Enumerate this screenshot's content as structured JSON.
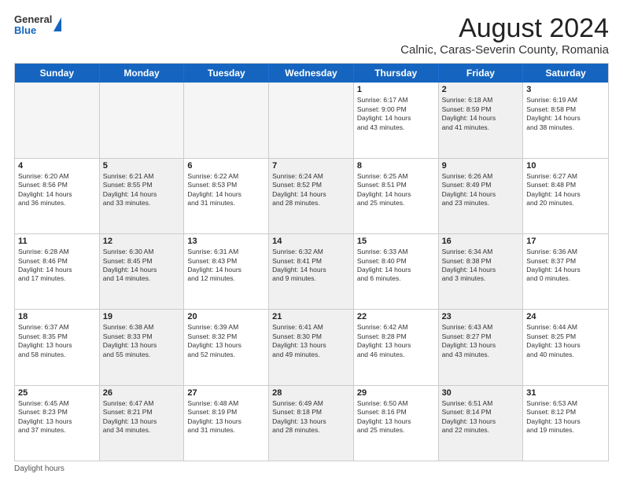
{
  "logo": {
    "general": "General",
    "blue": "Blue"
  },
  "title": "August 2024",
  "subtitle": "Calnic, Caras-Severin County, Romania",
  "days_of_week": [
    "Sunday",
    "Monday",
    "Tuesday",
    "Wednesday",
    "Thursday",
    "Friday",
    "Saturday"
  ],
  "weeks": [
    [
      {
        "day": "",
        "empty": true
      },
      {
        "day": "",
        "empty": true
      },
      {
        "day": "",
        "empty": true
      },
      {
        "day": "",
        "empty": true
      },
      {
        "day": "1",
        "shaded": false,
        "lines": [
          "Sunrise: 6:17 AM",
          "Sunset: 9:00 PM",
          "Daylight: 14 hours",
          "and 43 minutes."
        ]
      },
      {
        "day": "2",
        "shaded": true,
        "lines": [
          "Sunrise: 6:18 AM",
          "Sunset: 8:59 PM",
          "Daylight: 14 hours",
          "and 41 minutes."
        ]
      },
      {
        "day": "3",
        "shaded": false,
        "lines": [
          "Sunrise: 6:19 AM",
          "Sunset: 8:58 PM",
          "Daylight: 14 hours",
          "and 38 minutes."
        ]
      }
    ],
    [
      {
        "day": "4",
        "shaded": false,
        "lines": [
          "Sunrise: 6:20 AM",
          "Sunset: 8:56 PM",
          "Daylight: 14 hours",
          "and 36 minutes."
        ]
      },
      {
        "day": "5",
        "shaded": true,
        "lines": [
          "Sunrise: 6:21 AM",
          "Sunset: 8:55 PM",
          "Daylight: 14 hours",
          "and 33 minutes."
        ]
      },
      {
        "day": "6",
        "shaded": false,
        "lines": [
          "Sunrise: 6:22 AM",
          "Sunset: 8:53 PM",
          "Daylight: 14 hours",
          "and 31 minutes."
        ]
      },
      {
        "day": "7",
        "shaded": true,
        "lines": [
          "Sunrise: 6:24 AM",
          "Sunset: 8:52 PM",
          "Daylight: 14 hours",
          "and 28 minutes."
        ]
      },
      {
        "day": "8",
        "shaded": false,
        "lines": [
          "Sunrise: 6:25 AM",
          "Sunset: 8:51 PM",
          "Daylight: 14 hours",
          "and 25 minutes."
        ]
      },
      {
        "day": "9",
        "shaded": true,
        "lines": [
          "Sunrise: 6:26 AM",
          "Sunset: 8:49 PM",
          "Daylight: 14 hours",
          "and 23 minutes."
        ]
      },
      {
        "day": "10",
        "shaded": false,
        "lines": [
          "Sunrise: 6:27 AM",
          "Sunset: 8:48 PM",
          "Daylight: 14 hours",
          "and 20 minutes."
        ]
      }
    ],
    [
      {
        "day": "11",
        "shaded": false,
        "lines": [
          "Sunrise: 6:28 AM",
          "Sunset: 8:46 PM",
          "Daylight: 14 hours",
          "and 17 minutes."
        ]
      },
      {
        "day": "12",
        "shaded": true,
        "lines": [
          "Sunrise: 6:30 AM",
          "Sunset: 8:45 PM",
          "Daylight: 14 hours",
          "and 14 minutes."
        ]
      },
      {
        "day": "13",
        "shaded": false,
        "lines": [
          "Sunrise: 6:31 AM",
          "Sunset: 8:43 PM",
          "Daylight: 14 hours",
          "and 12 minutes."
        ]
      },
      {
        "day": "14",
        "shaded": true,
        "lines": [
          "Sunrise: 6:32 AM",
          "Sunset: 8:41 PM",
          "Daylight: 14 hours",
          "and 9 minutes."
        ]
      },
      {
        "day": "15",
        "shaded": false,
        "lines": [
          "Sunrise: 6:33 AM",
          "Sunset: 8:40 PM",
          "Daylight: 14 hours",
          "and 6 minutes."
        ]
      },
      {
        "day": "16",
        "shaded": true,
        "lines": [
          "Sunrise: 6:34 AM",
          "Sunset: 8:38 PM",
          "Daylight: 14 hours",
          "and 3 minutes."
        ]
      },
      {
        "day": "17",
        "shaded": false,
        "lines": [
          "Sunrise: 6:36 AM",
          "Sunset: 8:37 PM",
          "Daylight: 14 hours",
          "and 0 minutes."
        ]
      }
    ],
    [
      {
        "day": "18",
        "shaded": false,
        "lines": [
          "Sunrise: 6:37 AM",
          "Sunset: 8:35 PM",
          "Daylight: 13 hours",
          "and 58 minutes."
        ]
      },
      {
        "day": "19",
        "shaded": true,
        "lines": [
          "Sunrise: 6:38 AM",
          "Sunset: 8:33 PM",
          "Daylight: 13 hours",
          "and 55 minutes."
        ]
      },
      {
        "day": "20",
        "shaded": false,
        "lines": [
          "Sunrise: 6:39 AM",
          "Sunset: 8:32 PM",
          "Daylight: 13 hours",
          "and 52 minutes."
        ]
      },
      {
        "day": "21",
        "shaded": true,
        "lines": [
          "Sunrise: 6:41 AM",
          "Sunset: 8:30 PM",
          "Daylight: 13 hours",
          "and 49 minutes."
        ]
      },
      {
        "day": "22",
        "shaded": false,
        "lines": [
          "Sunrise: 6:42 AM",
          "Sunset: 8:28 PM",
          "Daylight: 13 hours",
          "and 46 minutes."
        ]
      },
      {
        "day": "23",
        "shaded": true,
        "lines": [
          "Sunrise: 6:43 AM",
          "Sunset: 8:27 PM",
          "Daylight: 13 hours",
          "and 43 minutes."
        ]
      },
      {
        "day": "24",
        "shaded": false,
        "lines": [
          "Sunrise: 6:44 AM",
          "Sunset: 8:25 PM",
          "Daylight: 13 hours",
          "and 40 minutes."
        ]
      }
    ],
    [
      {
        "day": "25",
        "shaded": false,
        "lines": [
          "Sunrise: 6:45 AM",
          "Sunset: 8:23 PM",
          "Daylight: 13 hours",
          "and 37 minutes."
        ]
      },
      {
        "day": "26",
        "shaded": true,
        "lines": [
          "Sunrise: 6:47 AM",
          "Sunset: 8:21 PM",
          "Daylight: 13 hours",
          "and 34 minutes."
        ]
      },
      {
        "day": "27",
        "shaded": false,
        "lines": [
          "Sunrise: 6:48 AM",
          "Sunset: 8:19 PM",
          "Daylight: 13 hours",
          "and 31 minutes."
        ]
      },
      {
        "day": "28",
        "shaded": true,
        "lines": [
          "Sunrise: 6:49 AM",
          "Sunset: 8:18 PM",
          "Daylight: 13 hours",
          "and 28 minutes."
        ]
      },
      {
        "day": "29",
        "shaded": false,
        "lines": [
          "Sunrise: 6:50 AM",
          "Sunset: 8:16 PM",
          "Daylight: 13 hours",
          "and 25 minutes."
        ]
      },
      {
        "day": "30",
        "shaded": true,
        "lines": [
          "Sunrise: 6:51 AM",
          "Sunset: 8:14 PM",
          "Daylight: 13 hours",
          "and 22 minutes."
        ]
      },
      {
        "day": "31",
        "shaded": false,
        "lines": [
          "Sunrise: 6:53 AM",
          "Sunset: 8:12 PM",
          "Daylight: 13 hours",
          "and 19 minutes."
        ]
      }
    ]
  ],
  "footer": "Daylight hours"
}
